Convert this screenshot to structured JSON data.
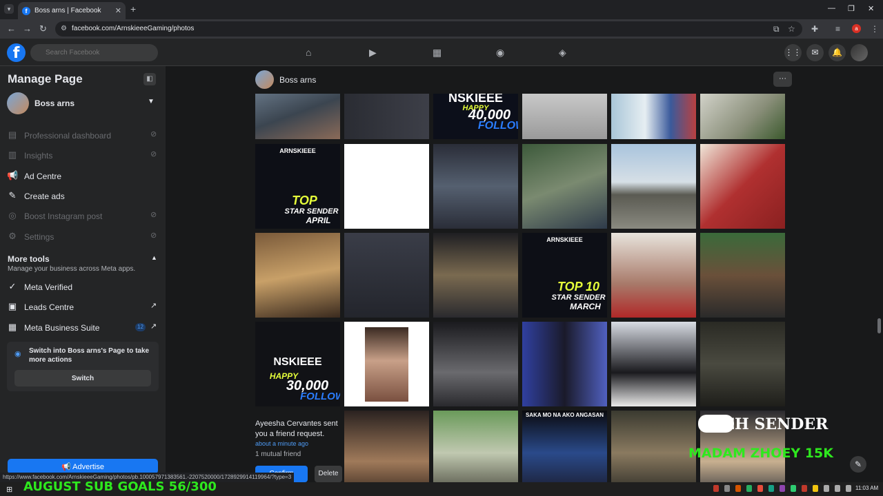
{
  "browser": {
    "tab_title": "Boss arns | Facebook",
    "tab_close": "✕",
    "new_tab": "+",
    "url": "facebook.com/ArnskieeeGaming/photos",
    "status_url": "https://www.facebook.com/ArnskieeeGaming/photos/pb.100057971383561.-2207520000/1728929914119964/?type=3"
  },
  "fb": {
    "search_placeholder": "Search Facebook"
  },
  "sidebar": {
    "title": "Manage Page",
    "page_name": "Boss arns",
    "items": [
      {
        "label": "Professional dashboard",
        "icon": "dashboard-icon"
      },
      {
        "label": "Insights",
        "icon": "insights-icon"
      },
      {
        "label": "Ad Centre",
        "icon": "megaphone-icon"
      },
      {
        "label": "Create ads",
        "icon": "pencil-icon"
      },
      {
        "label": "Boost Instagram post",
        "icon": "instagram-icon"
      },
      {
        "label": "Settings",
        "icon": "gear-icon"
      }
    ],
    "more_tools_title": "More tools",
    "more_tools_sub": "Manage your business across Meta apps.",
    "tools": [
      {
        "label": "Meta Verified",
        "icon": "verified-icon"
      },
      {
        "label": "Leads Centre",
        "icon": "leads-icon"
      },
      {
        "label": "Meta Business Suite",
        "icon": "briefcase-icon",
        "badge": "12"
      }
    ],
    "switch_text": "Switch into Boss arns's Page to take more actions",
    "switch_button": "Switch",
    "advertise_button": "Advertise"
  },
  "page_header": {
    "name": "Boss arns",
    "more": "···"
  },
  "photos": {
    "captions": {
      "follow_40k_top": "NSKIEEE",
      "follow_40k_happy": "HAPPY",
      "follow_40k_num": "40,000",
      "follow_40k_follow": "FOLLOW",
      "top_april_brand": "ARNSKIEEE",
      "top_april_top": "TOP",
      "top_april_star": "STAR SENDER",
      "top_april_month": "APRIL",
      "top_march_brand": "ARNSKIEEE",
      "top_march_top": "TOP 10",
      "top_march_star": "STAR SENDER",
      "top_march_month": "MARCH",
      "follow_30k_brand": "NSKIEEE",
      "follow_30k_happy": "HAPPY",
      "follow_30k_num": "30,000",
      "follow_30k_follow": "FOLLOW",
      "gaming_banner": "SAKA MO NA AKO ANGASAN"
    }
  },
  "notification": {
    "text": "Ayeesha Cervantes sent you a friend request.",
    "time": "about a minute ago",
    "mutual": "1 mutual friend",
    "confirm": "Confirm",
    "delete": "Delete"
  },
  "overlays": {
    "top_sender": "STEH SENDER",
    "zhoey": "MADAM ZHOEY 15K",
    "goals": "AUGUST SUB GOALS 56/300"
  },
  "taskbar": {
    "time": "11:03 AM"
  }
}
